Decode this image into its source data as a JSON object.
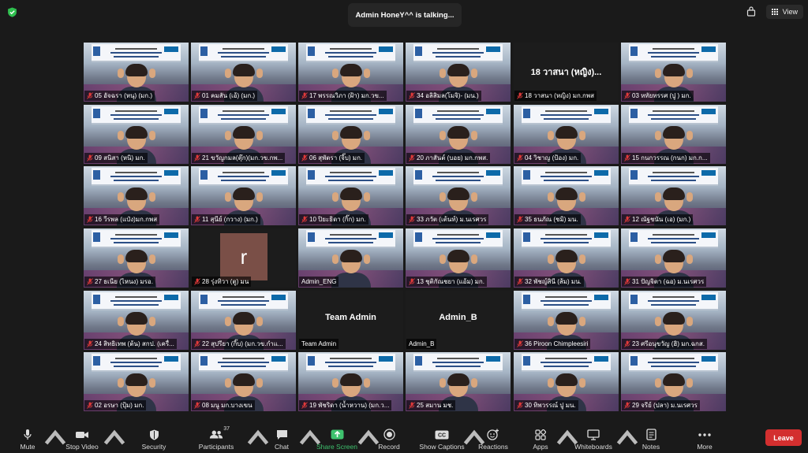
{
  "header": {
    "talking_text": "Admin HoneY^^ is talking...",
    "view_label": "View"
  },
  "tiles": [
    {
      "row": 0,
      "col": 0,
      "name": "05 อัจฉรา (หนุ) (มก.)",
      "type": "video",
      "muted": true
    },
    {
      "row": 0,
      "col": 1,
      "name": "01 คมสัน (เอ้) (มก.)",
      "type": "video",
      "muted": true
    },
    {
      "row": 0,
      "col": 2,
      "name": "17 พรรณวิภา (ฝ้า) มก.วข...",
      "type": "video",
      "muted": true
    },
    {
      "row": 0,
      "col": 3,
      "name": "34 อลิสิมล(โมจิ)- (มน.)",
      "type": "video",
      "muted": true
    },
    {
      "row": 0,
      "col": 4,
      "name": "18 วาสนา (หญิง) มก.กพส",
      "type": "name",
      "display": "18 วาสนา (หญิง)...",
      "muted": true
    },
    {
      "row": 0,
      "col": 5,
      "name": "03 หทัยทรรศ (ปู ) มก.",
      "type": "video",
      "muted": true
    },
    {
      "row": 1,
      "col": 0,
      "name": "09 สนิสา (หนิ) มก.",
      "type": "video",
      "muted": true
    },
    {
      "row": 1,
      "col": 1,
      "name": "21 ขวัญกมล(ตุ๊ก)(มก.วข.กพ...",
      "type": "video",
      "muted": true
    },
    {
      "row": 1,
      "col": 2,
      "name": "06 สุพัตรา (จิ๊บ) มก.",
      "type": "video",
      "muted": true
    },
    {
      "row": 1,
      "col": 3,
      "name": "20 ภาสันต์ (บอย) มก.กพส.",
      "type": "video",
      "muted": true
    },
    {
      "row": 1,
      "col": 4,
      "name": "04 วิชาญ (ป้อง) มก.",
      "type": "video",
      "muted": true
    },
    {
      "row": 1,
      "col": 5,
      "name": "15 กนกวรรณ (กนก) มก.ก...",
      "type": "video",
      "muted": true
    },
    {
      "row": 2,
      "col": 0,
      "name": "16 วีรพล (แป๋ง)มก.กพส",
      "type": "video",
      "muted": true
    },
    {
      "row": 2,
      "col": 1,
      "name": "11 สุนีย์ (กวาง) (มก.)",
      "type": "video",
      "muted": true
    },
    {
      "row": 2,
      "col": 2,
      "name": "10 ปิยะธิดา (กิ๊ก) มก.",
      "type": "video",
      "muted": true
    },
    {
      "row": 2,
      "col": 3,
      "name": "33 ภวัต (เต้นท์) ม.นเรศวร",
      "type": "video",
      "muted": true
    },
    {
      "row": 2,
      "col": 4,
      "name": "35 ธนภัณ (ชมิ) มน.",
      "type": "video",
      "muted": true
    },
    {
      "row": 2,
      "col": 5,
      "name": "12 ณัฐชนัน (เอ) (มก.)",
      "type": "video",
      "muted": true
    },
    {
      "row": 3,
      "col": 0,
      "name": "27 ธเนีย (ไหนง) มรอ.",
      "type": "video",
      "muted": true
    },
    {
      "row": 3,
      "col": 1,
      "name": "28 รุ่งทิวา (ตู) มน",
      "type": "avatar",
      "avatar_letter": "r",
      "muted": true
    },
    {
      "row": 3,
      "col": 2,
      "name": "Admin_ENG",
      "type": "video",
      "muted": false
    },
    {
      "row": 3,
      "col": 3,
      "name": "13 ชุติกัณชยา (แอ้ม) มก.",
      "type": "video",
      "muted": true
    },
    {
      "row": 3,
      "col": 4,
      "name": "32 พัชญ์สินี (ส้ม) มน.",
      "type": "video",
      "muted": true
    },
    {
      "row": 3,
      "col": 5,
      "name": "31 ปัญจิตา (ฉอ) ม.นเรศวร",
      "type": "video",
      "muted": true
    },
    {
      "row": 4,
      "col": 0,
      "name": "24 สิทธิเทพ (ต้น) สกป. (เครื่...",
      "type": "video",
      "muted": true
    },
    {
      "row": 4,
      "col": 1,
      "name": "22 สุปรียา (กิ๊บ) (มก.วข.กำแ...",
      "type": "video",
      "muted": true
    },
    {
      "row": 4,
      "col": 2,
      "name": "Team Admin",
      "type": "name",
      "display": "Team Admin",
      "muted": false
    },
    {
      "row": 4,
      "col": 3,
      "name": "Admin_B",
      "type": "name",
      "display": "Admin_B",
      "muted": false
    },
    {
      "row": 4,
      "col": 4,
      "name": "36 Piroon Chimpleesiri",
      "type": "video",
      "muted": true
    },
    {
      "row": 4,
      "col": 5,
      "name": "23 ศรีอนุขวัญ (ฮิ) มก.ฉกส.",
      "type": "video",
      "muted": true
    },
    {
      "row": 5,
      "col": 0,
      "name": "02 อรษา (ปุ้ม) มก.",
      "type": "video",
      "muted": true
    },
    {
      "row": 5,
      "col": 1,
      "name": "08 มนู มก.บางเขน",
      "type": "video",
      "muted": true
    },
    {
      "row": 5,
      "col": 2,
      "name": "19 พัชริดา (น้ำหวาน) (มก.ว...",
      "type": "video",
      "muted": true
    },
    {
      "row": 5,
      "col": 3,
      "name": "25 สมาน มช.",
      "type": "video",
      "muted": true
    },
    {
      "row": 5,
      "col": 4,
      "name": "30 ทิพวรรณ์ ปู มน.",
      "type": "video",
      "muted": true
    },
    {
      "row": 5,
      "col": 5,
      "name": "29 จรีย์ (ปลา) ม.นเรศวร",
      "type": "video",
      "muted": true
    }
  ],
  "toolbar": {
    "mute": "Mute",
    "stop_video": "Stop Video",
    "security": "Security",
    "participants": "Participants",
    "participants_count": "37",
    "chat": "Chat",
    "share_screen": "Share Screen",
    "record": "Record",
    "show_captions": "Show Captions",
    "reactions": "Reactions",
    "apps": "Apps",
    "whiteboards": "Whiteboards",
    "notes": "Notes",
    "more": "More",
    "leave": "Leave"
  },
  "colors": {
    "background": "#1a1a1a",
    "share_green": "#3ec26e",
    "leave_red": "#d32f2f",
    "security_shield_green": "#2fbf4f",
    "muted_red": "#e03a3a",
    "avatar_bg": "#7a4f47"
  }
}
